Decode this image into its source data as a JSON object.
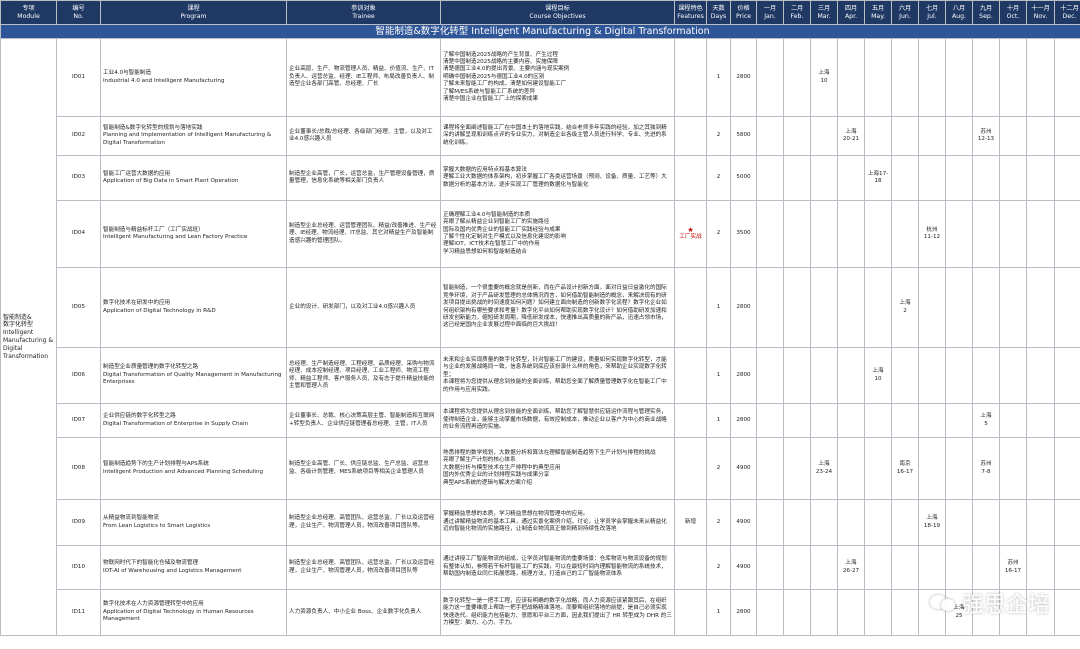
{
  "header": [
    {
      "zh": "专项",
      "en": "Module"
    },
    {
      "zh": "编号",
      "en": "No."
    },
    {
      "zh": "课程",
      "en": "Program"
    },
    {
      "zh": "参训对象",
      "en": "Trainee"
    },
    {
      "zh": "课程目标",
      "en": "Course Objectives"
    },
    {
      "zh": "课程特色",
      "en": "Features"
    },
    {
      "zh": "天数",
      "en": "Days"
    },
    {
      "zh": "价格",
      "en": "Price"
    },
    {
      "zh": "一月",
      "en": "Jan."
    },
    {
      "zh": "二月",
      "en": "Feb."
    },
    {
      "zh": "三月",
      "en": "Mar."
    },
    {
      "zh": "四月",
      "en": "Apr."
    },
    {
      "zh": "五月",
      "en": "May."
    },
    {
      "zh": "六月",
      "en": "Jun."
    },
    {
      "zh": "七月",
      "en": "Jul."
    },
    {
      "zh": "八月",
      "en": "Aug."
    },
    {
      "zh": "九月",
      "en": "Sep."
    },
    {
      "zh": "十月",
      "en": "Oct."
    },
    {
      "zh": "十一月",
      "en": "Nov."
    },
    {
      "zh": "十二月",
      "en": "Dec."
    }
  ],
  "banner": "智能制造&数字化转型 Intelligent Manufacturing & Digital Transformation",
  "module": [
    "智能制造&",
    "数字化转型",
    "Intelligent",
    "Manufacturing &",
    "Digital",
    "Transformation"
  ],
  "rows": [
    {
      "id": "ID01",
      "program": [
        "工业4.0与智能制造",
        "Industrial 4.0 and Intelligent Manufacturing"
      ],
      "trainee": "企业高层、生产、物流管理人员、精益、价值流、生产、IT负责人、运营总监、经理、IE工程师、布局改善负责人、制造型企业各部门高管、总经理、厂长",
      "objectives": [
        "了解中国制造2025战略的产生背景、产生过程",
        "清楚中国制造2025战略的主要内容、实施保障",
        "清楚德国工业4.0的提出背景、主要内涵与现实案例",
        "明确中国制造2025与德国工业4.0的区别",
        "了解未来智能工厂的构成，清楚如何建设智能工厂",
        "了解M/ES系统与智能工厂系统的差异",
        "清楚中国企业在智能工厂上的探索成果"
      ],
      "feature": "",
      "days": "1",
      "price": "2800",
      "cal": {
        "mar": [
          "上海",
          "10"
        ]
      }
    },
    {
      "id": "ID02",
      "program": [
        "智能制造&数字化转型的规划与落地实践",
        "Planning and Implementation of Intelligent Manufacturing & Digital Transformation"
      ],
      "trainee": "企业董事长/总裁/总经理、各级部门经理、主管，以及对工业4.0感兴趣人员",
      "objectives": [
        "课程将全面阐述智能工厂在中国本土的落地实践，结合老师多年实践的经验，加之其独到精深的讲解呈现和训练点评的专业实力，对制造企业各级主管人员进行科学、专业、先进的系统化训练。"
      ],
      "feature": "",
      "days": "2",
      "price": "5800",
      "cal": {
        "apr": [
          "上海",
          "20-21"
        ],
        "sep": [
          "苏州",
          "12-13"
        ]
      }
    },
    {
      "id": "ID03",
      "program": [
        "智能工厂运营大数据的应用",
        "Application of Big Data in Smart Plant Operation"
      ],
      "trainee": "制造型企业高管，厂长，运营总监，生产管理设备管理，质量管理，信息化系统等相关部门负责人",
      "objectives": [
        "掌握大数据的应用特点和基本算法",
        "理解工业大数据的体系架构，初步掌握工厂各类运营场景（预测、设备、质量、工艺等）大数据分析的基本方法，逐步实现工厂管理的数据化与智能化"
      ],
      "feature": "",
      "days": "2",
      "price": "5000",
      "cal": {
        "may": [
          "上海17-",
          "18"
        ]
      }
    },
    {
      "id": "ID04",
      "program": [
        "智能制造与精益标杆工厂（工厂实战班）",
        "Intelligent Manufacturing and Lean Factory Practice"
      ],
      "trainee": "制造型企业总经理、运营管理团队、精益/改善推进、生产经理、IE经理、物流经理、IT总监、其它对精益生产及智能制造感兴趣的管理团队。",
      "objectives": [
        "正确理解工业4.0与智能制造的本质",
        "亮眼了解从精益企业到智能工厂的实施路径",
        "国际及国内优秀企业的智能工厂实践经验与成果",
        "了解个性化定制对生产模式以及信息化建设的影响",
        "理解IOT、ICT技术在智慧工厂中的作用",
        "学习精益思想如何和智能制造结合"
      ],
      "feature": "工厂实战",
      "days": "2",
      "price": "3500",
      "cal": {
        "jul": [
          "杭州",
          "11-12"
        ]
      }
    },
    {
      "id": "ID05",
      "program": [
        "数字化技术在研发中的应用",
        "Application of Digital Technology in R&D"
      ],
      "trainee": "企业的设计、研发部门，以及对工业4.0感兴趣人员",
      "objectives": [
        "智能制造，一个很重要的概念就是创新，而在产品设计创新方面，面对日益日益激化的国际竞争环境，对于产品研发管理的总体情况而言，如何借助智能制造的概念，来解决现有的研发项目提出挑战的时间速度如何问题？如何建立面向制造的创新数字化流程？数字化企业如何组织架构有哪些要求和考量？数字化平台如何帮助实现数字化设计？如何借助研发加速和研发创新能力，缩短研发周期，降低研发成本，快速推出高质量的新产品，迅速占领市场，这已经是国内企业发展过程中面临的巨大挑战！"
      ],
      "feature": "",
      "days": "1",
      "price": "2800",
      "cal": {
        "jun": [
          "上海",
          "2"
        ]
      }
    },
    {
      "id": "ID06",
      "program": [
        "制造型企业质量管理的数字化转型之路",
        "Digital Transformation of Quality Management in Manufacturing Enterprises"
      ],
      "trainee": "总经理、生产制造经理、工程经理、品质经理、采购与物流经理、成本控制经理、项目经理、工业工程师、物流工程师、精益工程师、客户服务人员、及有志于提升精益技能的主管和管理人员",
      "objectives": [
        "未来和企业实现质量的数字化转型，针对智能工厂的建设，质量如何实现数字化转型，才能与企业的发展战略同一致，信息系统到底应该扮演什么样的角色，来帮助企业实现数字化转型；",
        "本课程将为您提供从理念到技能的全面训练，帮助您全面了解质量管理数字化在智能工厂中的作用与应用实践。"
      ],
      "feature": "",
      "days": "1",
      "price": "2800",
      "cal": {
        "may": [
          "上海",
          "10"
        ]
      }
    },
    {
      "id": "ID07",
      "program": [
        "企业供应链的数字化转型之路",
        "Digital Transformation of Enterprise in Supply Chain"
      ],
      "trainee": "企业董事长、总裁、核心决策高层主管、智能制造和互联网+转型负责人、企业供应链管理者总经理、主管，IT人员",
      "objectives": [
        "本课程将为您提供从理念到技能的全面训练，帮助您了解智慧供应链运作流程与管理实务，使得制造企业，能够主动掌握市场数据，有效控制成本，推动企业以客户为中心的商业战略的业务流程再造的实施。"
      ],
      "feature": "",
      "days": "1",
      "price": "2800",
      "cal": {
        "sep": [
          "上海",
          "5"
        ]
      }
    },
    {
      "id": "ID08",
      "program": [
        "智能制造趋势下的生产计划排程与APS系统",
        "Intelligent Production and Advanced Planning Scheduling"
      ],
      "trainee": "制造型企业高管、厂长、供应链总监、生产总监、运营总监、各级计划管理、MES系统项目等相关企业管理人员",
      "objectives": [
        "熟悉排程的数学规划，大数据分析和算法在理解智能制造趋势下生产计划与排程的挑战",
        "亮眼了解生产计划的核心体系",
        "大数据分析与模型技术在生产排程中的典型应用",
        "国内外优秀企业的计划排程实践与成果分享",
        "典型APS系统的逻辑与解决方案介绍"
      ],
      "feature": "",
      "days": "2",
      "price": "4900",
      "cal": {
        "mar": [
          "上海",
          "23-24"
        ],
        "jun": [
          "南京",
          "16-17"
        ],
        "sep": [
          "苏州",
          "7-8"
        ]
      }
    },
    {
      "id": "ID09",
      "program": [
        "从精益物流到智能物流",
        "From Lean Logistics to Smart Logistics"
      ],
      "trainee": "制造型企业总经理、高管团队、运营总监、厂长以及运营经理，企业生产、物流管理人员，物流改善项目团队等。",
      "objectives": [
        "掌握精益思想的本质，学习精益思想在物流管理中的应用。",
        "通过讲解精益物流的基本工具，通过实景化案例介绍，讨论，让学员学会掌握未来从精益化迈向智能化物流的实施路径，让制造业物流真正做到精到持续性改落地"
      ],
      "feature": "新增",
      "days": "2",
      "price": "4900",
      "cal": {
        "jul": [
          "上海",
          "18-19"
        ]
      }
    },
    {
      "id": "ID10",
      "program": [
        "物联网时代下的智能化仓储及物流管理",
        "IOT-AI of Warehousing and Logistics Management"
      ],
      "trainee": "制造型企业总经理、高管团队、运营总监、厂长以及运营经理，企业生产、物流管理人员，物流改善项目团队等",
      "objectives": [
        "通过讲授工厂智能物流的组成，让学员对智能物流的重要场景：仓库物流与物流设备的规划有整体认知，参照若干标杆智能工厂的实践，可以在最短时间内理解智能物流的系统技术，帮助国内制造业同仁拓展思路，梳理方法，打造自己的工厂智能物流体系"
      ],
      "feature": "",
      "days": "2",
      "price": "4900",
      "cal": {
        "apr": [
          "上海",
          "26-27"
        ],
        "oct": [
          "苏州",
          "16-17"
        ]
      }
    },
    {
      "id": "ID11",
      "program": [
        "数字化技术在人力资源管理转型中的应用",
        "Application of Digital Technology in Human Resources Management"
      ],
      "trainee": "人力资源负责人、中小企业 Boss、企业数字化负责人",
      "objectives": [
        "数字化转型一是一把手工程，应该有明确的数字化战略，而人力资源应该紧跟其后，在组织能力这一重要维度上帮助一把手把战略精准落地。而要帮组织落地的前提，是自己必须实现快速迭代。组织能力包括能力、意愿和平台三方面，因此我们提出了 HR 转型成为 DHR 的三力模型：脑力、心力、手力。"
      ],
      "feature": "",
      "days": "1",
      "price": "2800",
      "cal": {
        "aug": [
          "上海",
          "25"
        ]
      }
    }
  ],
  "watermark": "强思企培",
  "colors": {
    "header_bg": "#1f3864",
    "banner_bg": "#2e5597",
    "feature_red": "#c00000",
    "grid": "#b9bec6"
  }
}
